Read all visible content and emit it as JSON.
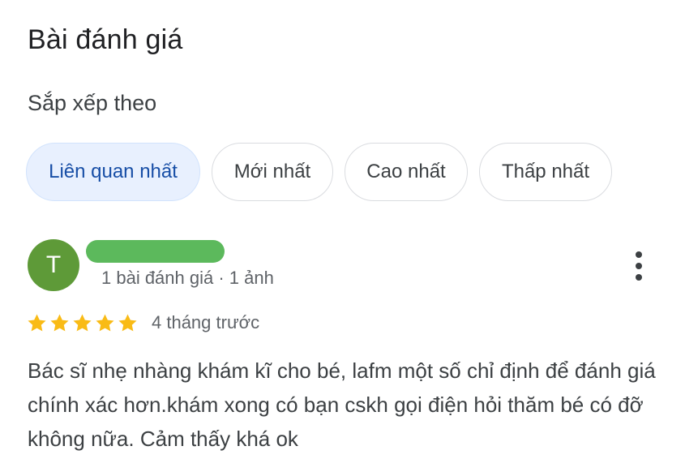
{
  "header": {
    "title": "Bài đánh giá"
  },
  "sort": {
    "label": "Sắp xếp theo",
    "options": [
      {
        "label": "Liên quan nhất",
        "selected": true
      },
      {
        "label": "Mới nhất",
        "selected": false
      },
      {
        "label": "Cao nhất",
        "selected": false
      },
      {
        "label": "Thấp nhất",
        "selected": false
      }
    ]
  },
  "review": {
    "avatar_initial": "T",
    "avatar_color": "#5e9a38",
    "name_redaction_color": "#5cb95c",
    "reviewer_meta": "1 bài đánh giá · 1 ảnh",
    "rating": 5,
    "rating_max": 5,
    "star_color": "#f9bb16",
    "time": "4 tháng trước",
    "text": "Bác sĩ nhẹ nhàng khám kĩ cho bé, lafm một số chỉ định để đánh giá chính xác hơn.khám xong có bạn cskh gọi điện hỏi thăm bé có đỡ không nữa. Cảm thấy khá ok",
    "more_icon": "more-vertical-icon"
  }
}
